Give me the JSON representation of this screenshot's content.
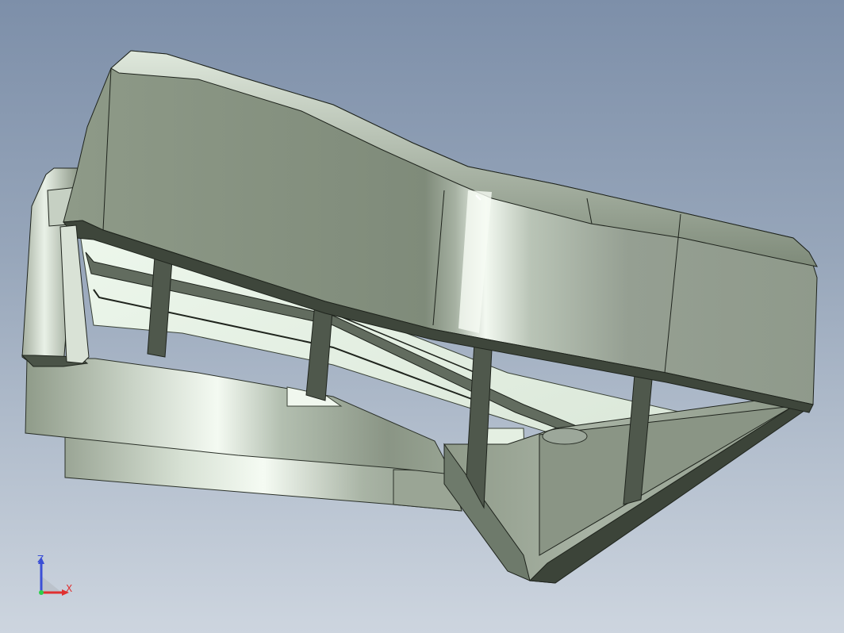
{
  "viewport": {
    "background_top": "#7d8fa9",
    "background_bottom": "#cdd5df"
  },
  "model": {
    "shade_color": "#8a9584",
    "edge_color": "#1f241d",
    "highlight_color": "#eef6ec"
  },
  "triad": {
    "z_label": "Z",
    "x_label": "X",
    "z_color": "#3b4fd6",
    "x_color": "#e03030",
    "origin_color": "#2ad04a"
  }
}
